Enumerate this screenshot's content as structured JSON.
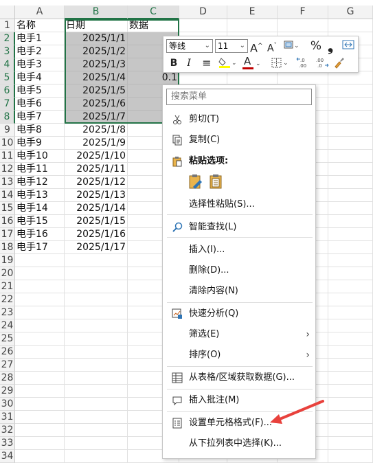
{
  "sheet": {
    "columns": [
      "A",
      "B",
      "C",
      "D",
      "E",
      "F",
      "G"
    ],
    "selected_columns": [
      "B",
      "C"
    ],
    "rows": [
      "1",
      "2",
      "3",
      "4",
      "5",
      "6",
      "7",
      "8",
      "9",
      "10",
      "11",
      "12",
      "13",
      "14",
      "15",
      "16",
      "17",
      "18",
      "19",
      "20",
      "21",
      "22",
      "23",
      "24",
      "25",
      "26",
      "27",
      "28",
      "29",
      "30",
      "31",
      "32",
      "33",
      "34"
    ],
    "selected_rows": [
      "2",
      "3",
      "4",
      "5",
      "6",
      "7",
      "8"
    ],
    "headers": {
      "name": "名称",
      "date": "日期",
      "value": "数据"
    },
    "data": [
      {
        "name": "电手1",
        "date": "2025/1/1"
      },
      {
        "name": "电手2",
        "date": "2025/1/2"
      },
      {
        "name": "电手3",
        "date": "2025/1/3"
      },
      {
        "name": "电手4",
        "date": "2025/1/4",
        "value": "0.1"
      },
      {
        "name": "电手5",
        "date": "2025/1/5"
      },
      {
        "name": "电手6",
        "date": "2025/1/6"
      },
      {
        "name": "电手7",
        "date": "2025/1/7"
      },
      {
        "name": "电手8",
        "date": "2025/1/8"
      },
      {
        "name": "电手9",
        "date": "2025/1/9"
      },
      {
        "name": "电手10",
        "date": "2025/1/10"
      },
      {
        "name": "电手11",
        "date": "2025/1/11"
      },
      {
        "name": "电手12",
        "date": "2025/1/12"
      },
      {
        "name": "电手13",
        "date": "2025/1/13"
      },
      {
        "name": "电手14",
        "date": "2025/1/14"
      },
      {
        "name": "电手15",
        "date": "2025/1/15"
      },
      {
        "name": "电手16",
        "date": "2025/1/16"
      },
      {
        "name": "电手17",
        "date": "2025/1/17"
      }
    ],
    "selection_color": "#217346",
    "highlight_color": "#c6c6c6"
  },
  "mini_toolbar": {
    "font_name": "等线",
    "font_size": "11",
    "grow_font": "A",
    "shrink_font": "A",
    "percent": "%",
    "comma": "❟",
    "bold": "B",
    "italic": "I",
    "align": "≡",
    "font_color_letter": "A",
    "decimals_more": "←.0 .00",
    "decimals_less": ".00 →.0",
    "font_color": "#c00000",
    "fill_color": "#ffff00",
    "icons": [
      "grow-font-icon",
      "shrink-font-icon",
      "number-format-icon",
      "percent-icon",
      "comma-icon",
      "merge-icon",
      "bold-icon",
      "italic-icon",
      "align-icon",
      "fill-color-icon",
      "font-color-icon",
      "borders-icon",
      "increase-decimal-icon",
      "decrease-decimal-icon",
      "format-painter-icon"
    ]
  },
  "context_menu": {
    "search_placeholder": "搜索菜单",
    "items": [
      {
        "label": "剪切(T)",
        "icon": "scissors-icon"
      },
      {
        "label": "复制(C)",
        "icon": "copy-icon"
      },
      {
        "label": "粘贴选项:",
        "icon": "paste-icon"
      },
      {
        "label": "选择性粘贴(S)...",
        "icon": ""
      },
      {
        "label": "智能查找(L)",
        "icon": "smart-lookup-icon"
      },
      {
        "label": "插入(I)...",
        "icon": ""
      },
      {
        "label": "删除(D)...",
        "icon": ""
      },
      {
        "label": "清除内容(N)",
        "icon": ""
      },
      {
        "label": "快速分析(Q)",
        "icon": "quick-analysis-icon"
      },
      {
        "label": "筛选(E)",
        "icon": "",
        "submenu": true
      },
      {
        "label": "排序(O)",
        "icon": "",
        "submenu": true
      },
      {
        "label": "从表格/区域获取数据(G)...",
        "icon": "table-icon"
      },
      {
        "label": "插入批注(M)",
        "icon": "comment-icon"
      },
      {
        "label": "设置单元格格式(F)...",
        "icon": "format-cells-icon"
      },
      {
        "label": "从下拉列表中选择(K)...",
        "icon": ""
      }
    ],
    "submenu_arrow": "›"
  },
  "annotation": {
    "arrow_color": "#e8413c"
  }
}
